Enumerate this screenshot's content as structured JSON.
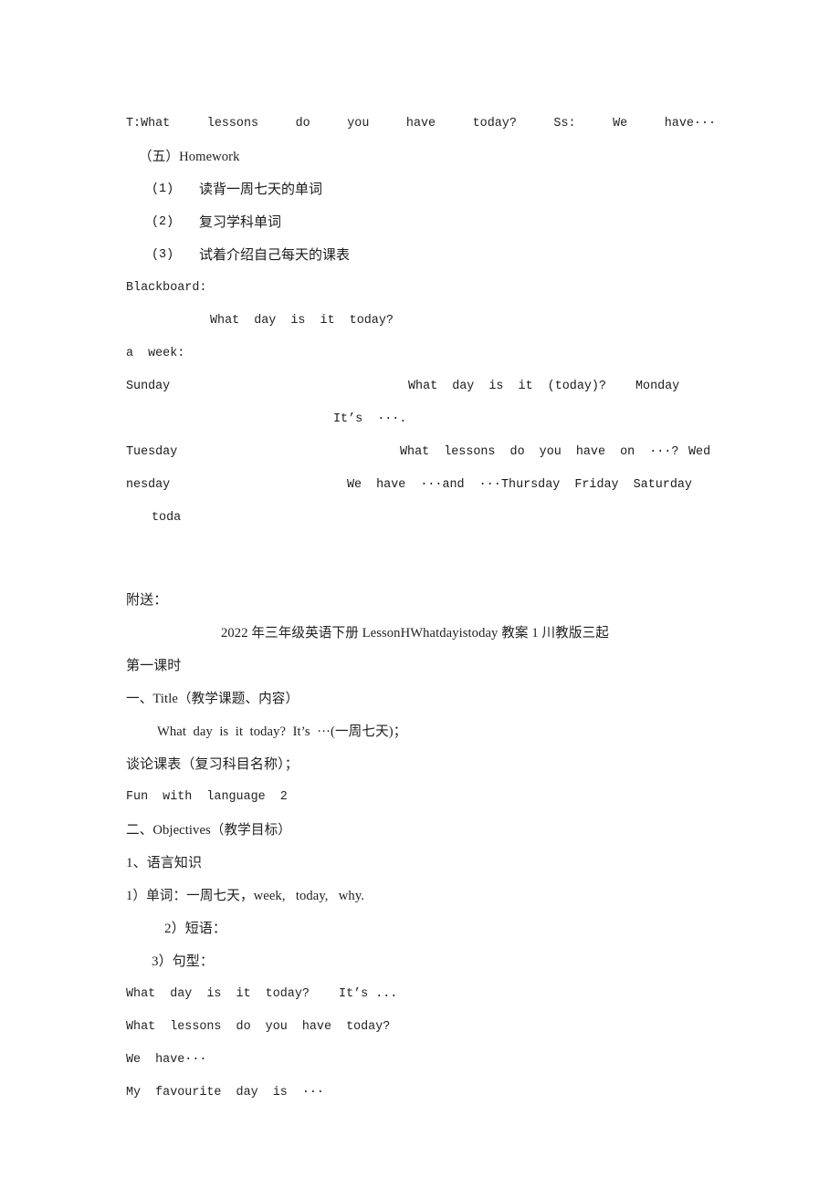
{
  "document": {
    "page_background": "#ffffff",
    "text_color": "#1f1f1f",
    "lines": {
      "l1_dialogue": "T:What  lessons  do  you  have  today?  Ss:  We  have···",
      "l2_homework_heading": "（五）Homework",
      "l3_hw1_num": "(1)",
      "l3_hw1_text": "读背一周七天的单词",
      "l4_hw2_num": "(2)",
      "l4_hw2_text": "复习学科单词",
      "l5_hw3_num": "(3)",
      "l5_hw3_text": "试着介绍自己每天的课表",
      "l6_blackboard": "Blackboard:",
      "l7_bb_question": "What  day  is  it  today?",
      "l8_a_week": "a  week:",
      "l9_sunday": "Sunday",
      "l9_question": "What  day  is  it  (today)?",
      "l9_monday": "Monday",
      "l10_its": "It’s  ···.",
      "l11_tuesday": "Tuesday",
      "l11_question": "What  lessons  do  you  have  on  ···?",
      "l11_wed": "Wed",
      "l12_nesday": "nesday",
      "l12_answer": "We  have  ···and  ···",
      "l12_days": "Thursday  Friday  Saturday",
      "l13_toda": "toda",
      "l14_fusong": "附送：",
      "l15_title": "2022 年三年级英语下册 LessonHWhatdayistoday 教案 1 川教版三起",
      "l16_period": "第一课时",
      "l17_title_heading": "一、Title（教学课题、内容）",
      "l18_title_body": "What  day  is  it  today?  It’s  ···(一周七天)；",
      "l19_talk": "谈论课表（复习科目名称）；",
      "l20_fun": "Fun  with  language  2",
      "l21_objectives_heading": "二、Objectives（教学目标）",
      "l22_lang_knowledge": "1、语言知识",
      "l23_words": "1）单词：一周七天，week,   today,   why.",
      "l24_phrases": "2）短语：",
      "l25_patterns": "3）句型：",
      "l26_p1": "What  day  is  it  today?    It’s ...",
      "l27_p2": "What  lessons  do  you  have  today?",
      "l28_p3": "We  have···",
      "l29_p4": "My  favourite  day  is  ···"
    }
  }
}
